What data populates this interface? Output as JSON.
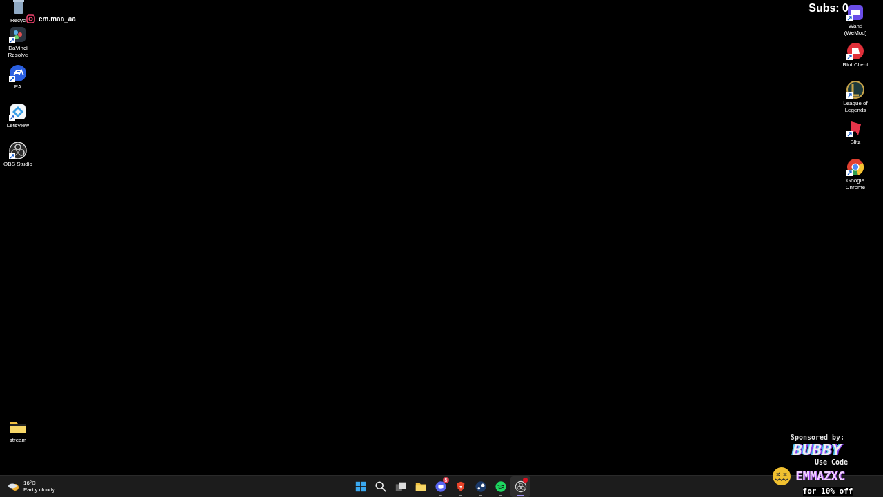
{
  "desktop": {
    "left_icons": [
      {
        "label": "Recyc",
        "kind": "recycle",
        "shortcut": false
      },
      {
        "label": "DaVinci Resolve",
        "kind": "davinci",
        "shortcut": true
      },
      {
        "label": "EA",
        "kind": "ea",
        "shortcut": true
      },
      {
        "label": "LetsView",
        "kind": "letsview",
        "shortcut": true
      },
      {
        "label": "OBS Studio",
        "kind": "obs",
        "shortcut": true
      }
    ],
    "bottom_left_icons": [
      {
        "label": "stream",
        "kind": "folder",
        "shortcut": false
      }
    ],
    "right_icons": [
      {
        "label": "Wand (WeMod)",
        "kind": "wemod",
        "shortcut": true
      },
      {
        "label": "Riot Client",
        "kind": "riot",
        "shortcut": true
      },
      {
        "label": "League of Legends",
        "kind": "lol",
        "shortcut": true
      },
      {
        "label": "Blitz",
        "kind": "blitz",
        "shortcut": true
      },
      {
        "label": "Google Chrome",
        "kind": "chrome",
        "shortcut": true
      }
    ]
  },
  "overlays": {
    "instagram_handle": "em.maa_aa",
    "subs": "Subs: 0",
    "sponsor": {
      "heading": "Sponsored by:",
      "brand": "BUBBY",
      "code_label": "Use Code",
      "code": "EMMAZXC",
      "discount": "for 10% off"
    }
  },
  "taskbar": {
    "weather": {
      "temperature": "16°C",
      "condition": "Partly cloudy"
    },
    "apps": [
      {
        "kind": "start",
        "running": false,
        "active": false
      },
      {
        "kind": "search",
        "running": false,
        "active": false
      },
      {
        "kind": "taskview",
        "running": false,
        "active": false
      },
      {
        "kind": "explorer",
        "running": false,
        "active": false
      },
      {
        "kind": "discord",
        "running": true,
        "active": false,
        "badge": "5"
      },
      {
        "kind": "brave",
        "running": true,
        "active": false
      },
      {
        "kind": "steam",
        "running": true,
        "active": false
      },
      {
        "kind": "spotify",
        "running": true,
        "active": false
      },
      {
        "kind": "obs",
        "running": true,
        "active": true,
        "alert": true
      }
    ]
  }
}
